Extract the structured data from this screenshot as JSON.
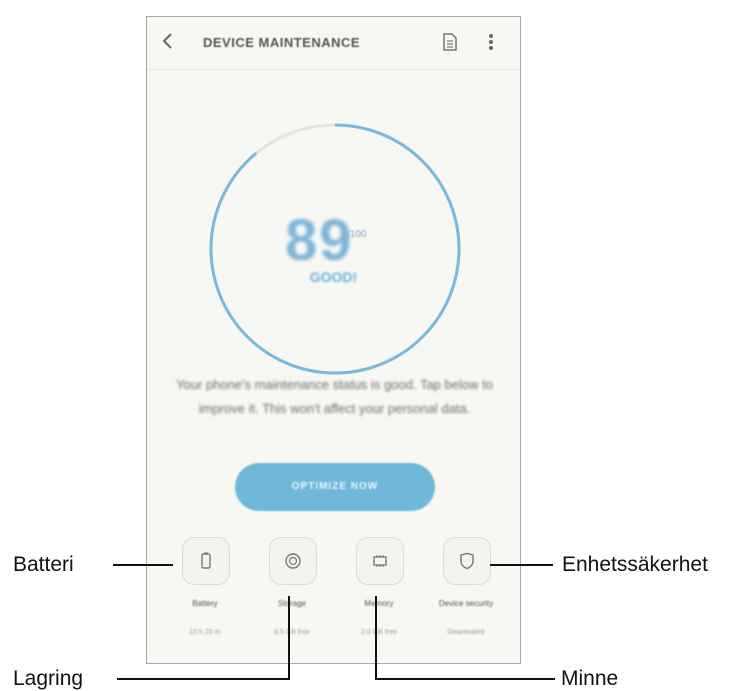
{
  "header": {
    "title": "DEVICE MAINTENANCE",
    "back_icon": "chevron-left-icon",
    "report_icon": "document-icon",
    "more_icon": "more-vertical-icon"
  },
  "score": {
    "value": 89,
    "value_text": "89",
    "max_text": "/100",
    "status": "GOOD!",
    "accent": "#79b9dd"
  },
  "description": "Your phone's maintenance status is good. Tap below to improve it. This won't affect your personal data.",
  "optimize_button": "OPTIMIZE NOW",
  "modules": [
    {
      "label": "Battery",
      "value": "10 h 20 m",
      "icon": "battery-icon"
    },
    {
      "label": "Storage",
      "value": "8.5 GB free",
      "icon": "storage-icon"
    },
    {
      "label": "Memory",
      "value": "2.0 GB free",
      "icon": "memory-icon"
    },
    {
      "label": "Device security",
      "value": "Deactivated",
      "icon": "shield-icon"
    }
  ],
  "callouts": {
    "battery": "Batteri",
    "storage": "Lagring",
    "memory": "Minne",
    "security": "Enhetssäkerhet"
  }
}
